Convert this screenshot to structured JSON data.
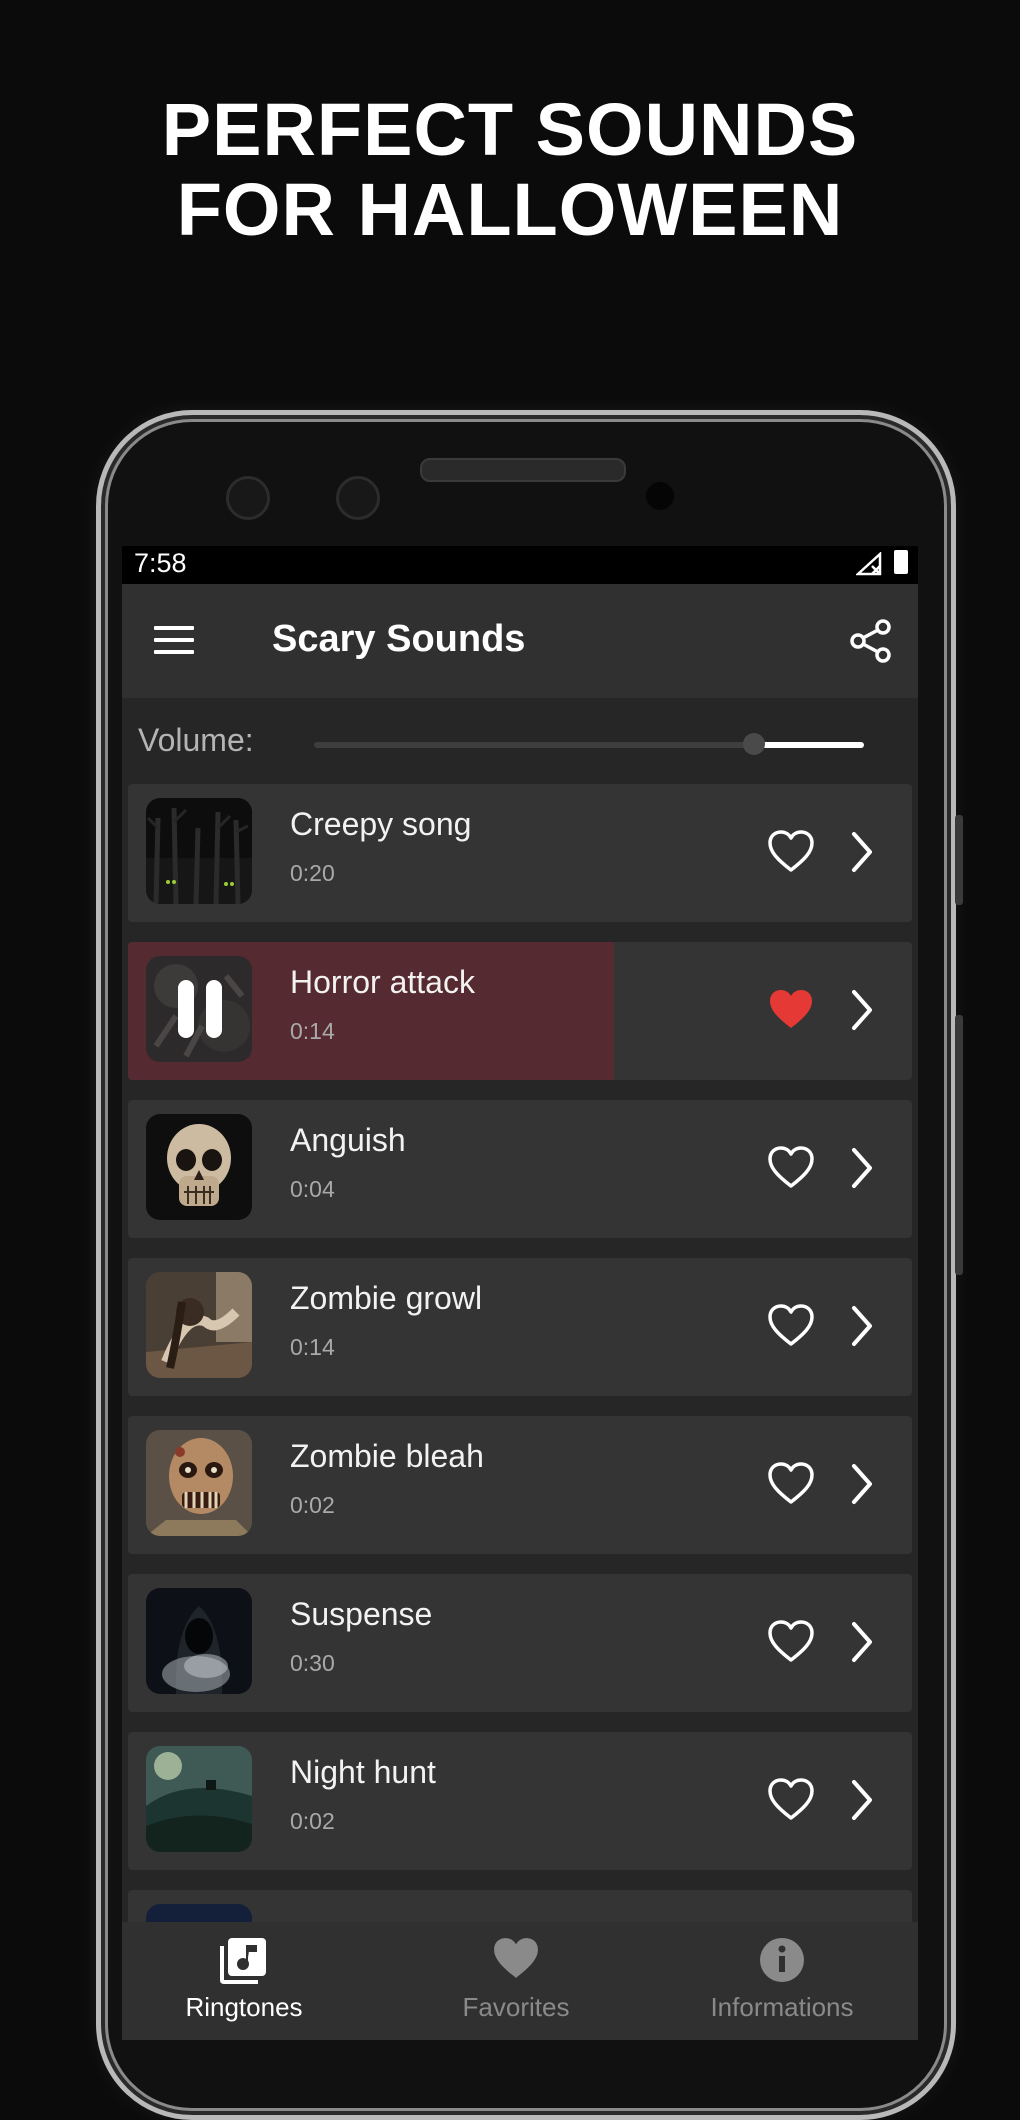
{
  "promo": {
    "line1": "PERFECT SOUNDS",
    "line2": "FOR HALLOWEEN"
  },
  "status_bar": {
    "time": "7:58"
  },
  "app_bar": {
    "title": "Scary Sounds",
    "menu_icon": "menu-icon",
    "share_icon": "share-icon"
  },
  "volume": {
    "label": "Volume:",
    "level": 0.8
  },
  "colors": {
    "background": "#0b0b0b",
    "card": "#343434",
    "playing_fill": "#552a30",
    "favorite_active": "#e53935",
    "nav_active": "#ffffff",
    "nav_inactive": "#8a8a8a"
  },
  "sounds": [
    {
      "name": "Creepy song",
      "duration": "0:20",
      "favorite": false,
      "playing": false,
      "thumb": "dark-forest"
    },
    {
      "name": "Horror attack",
      "duration": "0:14",
      "favorite": true,
      "playing": true,
      "progress": 0.62,
      "thumb": "shadow-hands"
    },
    {
      "name": "Anguish",
      "duration": "0:04",
      "favorite": false,
      "playing": false,
      "thumb": "skull"
    },
    {
      "name": "Zombie growl",
      "duration": "0:14",
      "favorite": false,
      "playing": false,
      "thumb": "crawling-ghost"
    },
    {
      "name": "Zombie bleah",
      "duration": "0:02",
      "favorite": false,
      "playing": false,
      "thumb": "zombie-face"
    },
    {
      "name": "Suspense",
      "duration": "0:30",
      "favorite": false,
      "playing": false,
      "thumb": "hooded-figure"
    },
    {
      "name": "Night hunt",
      "duration": "0:02",
      "favorite": false,
      "playing": false,
      "thumb": "moonlit-hill"
    }
  ],
  "bottom_nav": [
    {
      "label": "Ringtones",
      "icon": "music-library-icon",
      "active": true
    },
    {
      "label": "Favorites",
      "icon": "heart-icon",
      "active": false
    },
    {
      "label": "Informations",
      "icon": "info-icon",
      "active": false
    }
  ]
}
